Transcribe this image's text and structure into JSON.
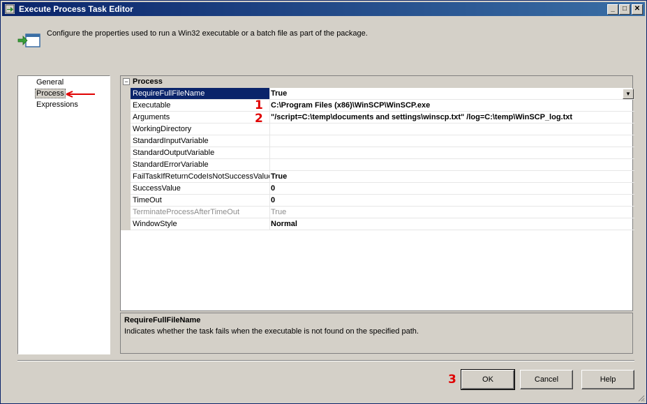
{
  "window": {
    "title": "Execute Process Task Editor",
    "minimize_glyph": "_",
    "maximize_glyph": "□",
    "close_glyph": "✕"
  },
  "header": {
    "description": "Configure the properties used to run a Win32 executable or a batch file as part of the package.",
    "icon": "execute-process-icon"
  },
  "nav": {
    "items": [
      {
        "label": "General"
      },
      {
        "label": "Process"
      },
      {
        "label": "Expressions"
      }
    ],
    "selected": "Process"
  },
  "grid": {
    "category": "Process",
    "expander": "−",
    "rows": [
      {
        "name": "RequireFullFileName",
        "value": "True"
      },
      {
        "name": "Executable",
        "value": "C:\\Program Files (x86)\\WinSCP\\WinSCP.exe"
      },
      {
        "name": "Arguments",
        "value": "\"/script=C:\\temp\\documents and settings\\winscp.txt\" /log=C:\\temp\\WinSCP_log.txt"
      },
      {
        "name": "WorkingDirectory",
        "value": ""
      },
      {
        "name": "StandardInputVariable",
        "value": ""
      },
      {
        "name": "StandardOutputVariable",
        "value": ""
      },
      {
        "name": "StandardErrorVariable",
        "value": ""
      },
      {
        "name": "FailTaskIfReturnCodeIsNotSuccessValue",
        "value": "True"
      },
      {
        "name": "SuccessValue",
        "value": "0"
      },
      {
        "name": "TimeOut",
        "value": "0"
      },
      {
        "name": "TerminateProcessAfterTimeOut",
        "value": "True"
      },
      {
        "name": "WindowStyle",
        "value": "Normal"
      }
    ],
    "selected_row": "RequireFullFileName",
    "disabled_row": "TerminateProcessAfterTimeOut",
    "dropdown_glyph": "▼"
  },
  "help": {
    "title": "RequireFullFileName",
    "description": "Indicates whether the task fails when the executable is not found on the specified path."
  },
  "buttons": {
    "ok": "OK",
    "cancel": "Cancel",
    "help": "Help"
  },
  "annotations": {
    "marker1": "1",
    "marker2": "2",
    "marker3": "3",
    "color": "#e00000"
  },
  "colors": {
    "titlebar": "#0a246a",
    "selection": "#0a246a",
    "chrome": "#d4d0c8"
  }
}
